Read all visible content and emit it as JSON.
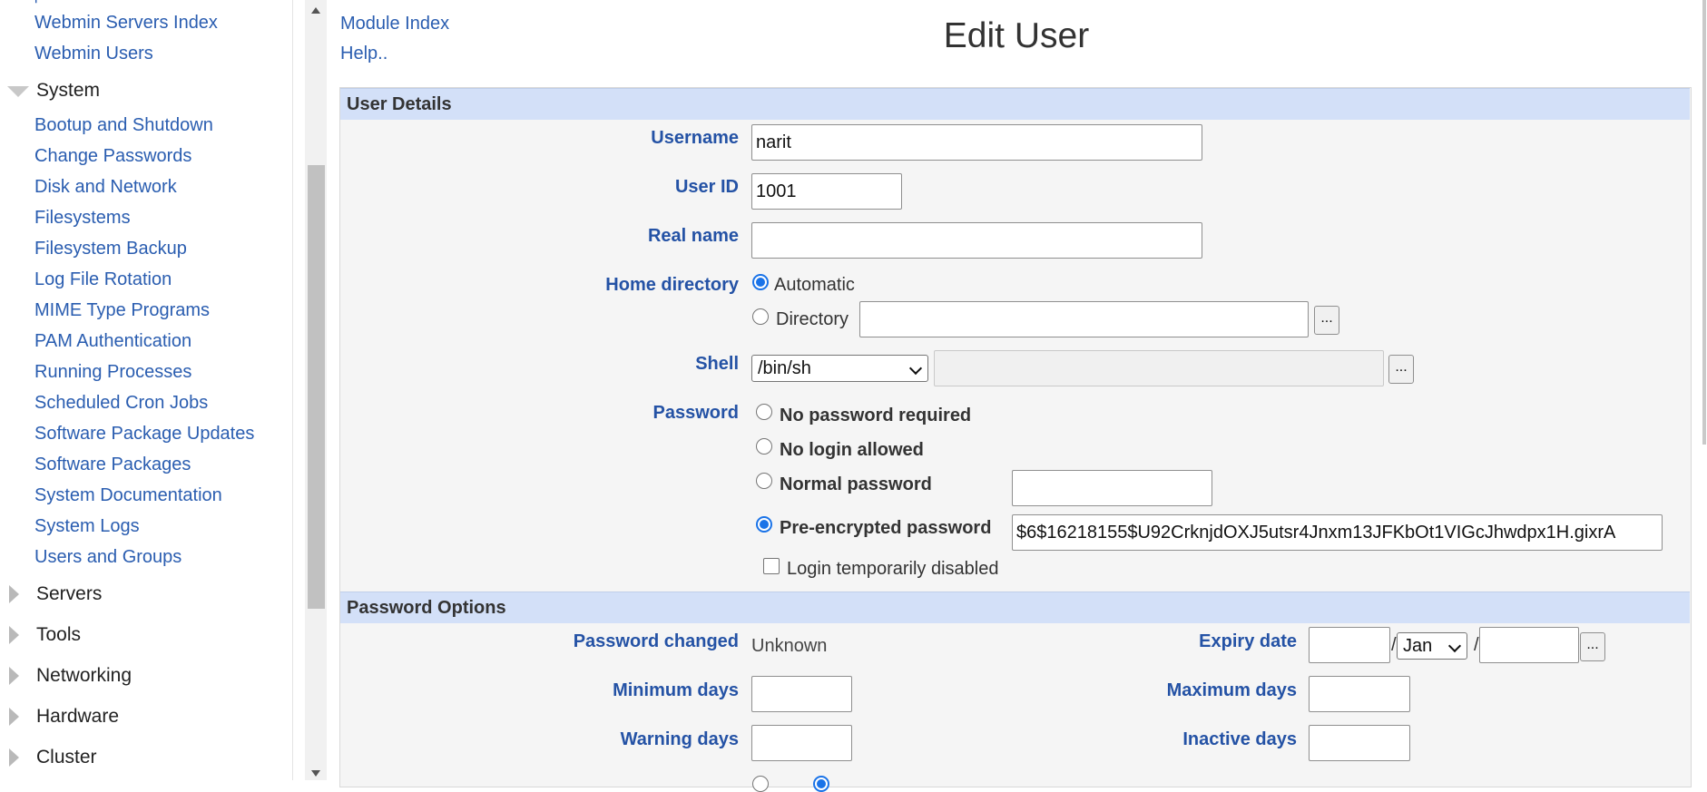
{
  "sidebar": {
    "webmin_links": [
      "Webmin Servers Index",
      "Webmin Users"
    ],
    "system_label": "System",
    "system_links": [
      "Bootup and Shutdown",
      "Change Passwords",
      "Disk and Network",
      "Filesystems",
      "Filesystem Backup",
      "Log File Rotation",
      "MIME Type Programs",
      "PAM Authentication",
      "Running Processes",
      "Scheduled Cron Jobs",
      "Software Package Updates",
      "Software Packages",
      "System Documentation",
      "System Logs",
      "Users and Groups"
    ],
    "categories": [
      "Servers",
      "Tools",
      "Networking",
      "Hardware",
      "Cluster"
    ]
  },
  "header": {
    "module_index": "Module Index",
    "help": "Help..",
    "title": "Edit User"
  },
  "user_details": {
    "section_title": "User Details",
    "username_label": "Username",
    "username_value": "narit",
    "uid_label": "User ID",
    "uid_value": "1001",
    "realname_label": "Real name",
    "realname_value": "",
    "home_label": "Home directory",
    "home_automatic": "Automatic",
    "home_directory": "Directory",
    "home_selected": "Automatic",
    "browse_label": "...",
    "shell_label": "Shell",
    "shell_value": "/bin/sh",
    "password_label": "Password",
    "pw_none": "No password required",
    "pw_nologin": "No login allowed",
    "pw_normal": "Normal password",
    "pw_pre": "Pre-encrypted password",
    "pw_selected": "Pre-encrypted password",
    "pw_pre_value": "$6$16218155$U92CrknjdOXJ5utsr4Jnxm13JFKbOt1VIGcJhwdpx1H.gixrA",
    "login_disabled": "Login temporarily disabled",
    "login_disabled_checked": false
  },
  "password_options": {
    "section_title": "Password Options",
    "changed_label": "Password changed",
    "changed_value": "Unknown",
    "expiry_label": "Expiry date",
    "expiry_month": "Jan",
    "date_sep": "/",
    "min_days_label": "Minimum days",
    "max_days_label": "Maximum days",
    "warn_days_label": "Warning days",
    "inactive_days_label": "Inactive days"
  }
}
